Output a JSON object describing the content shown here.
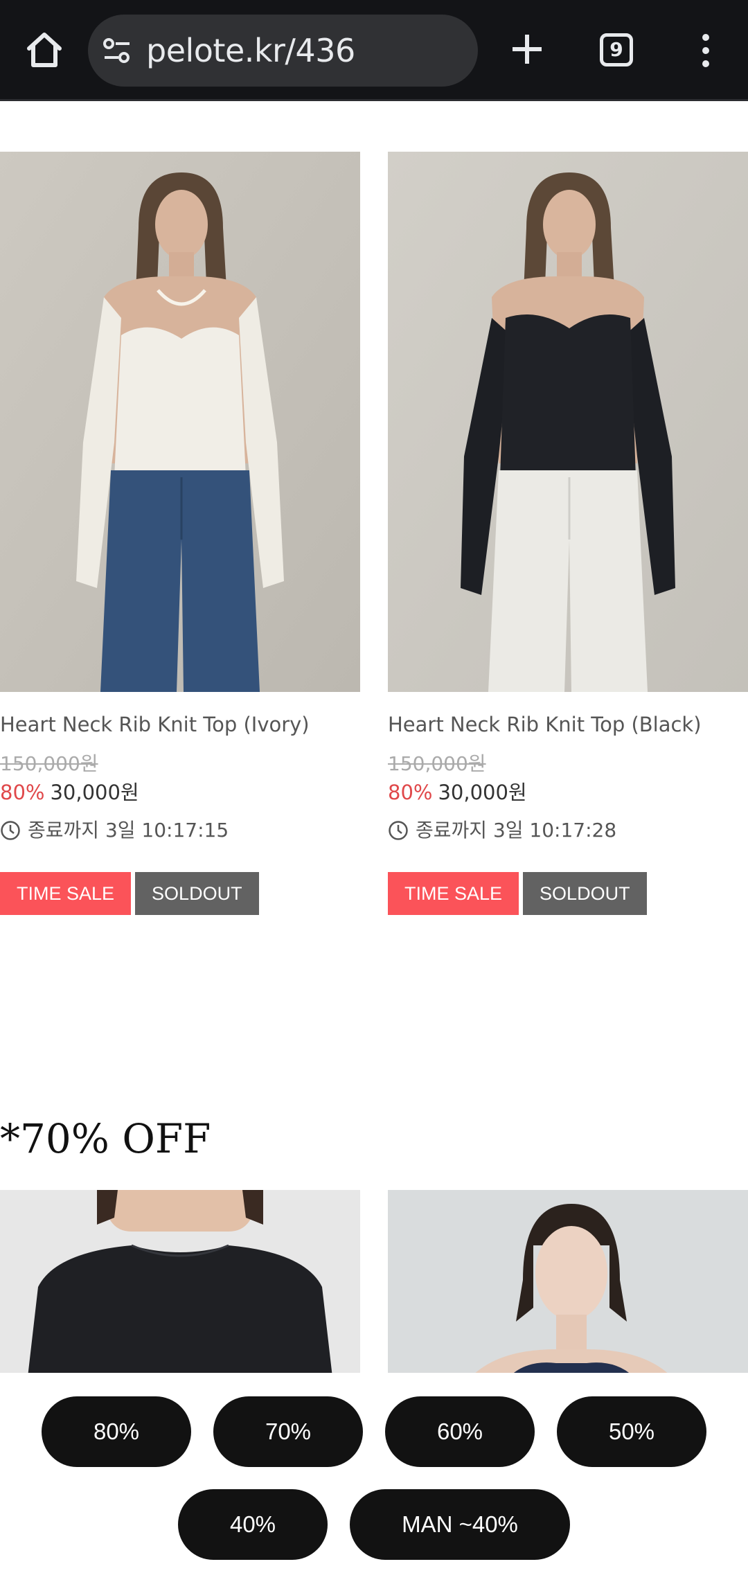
{
  "browser": {
    "url": "pelote.kr/436",
    "tab_count": "9"
  },
  "products": [
    {
      "name": "Heart Neck Rib Knit Top (Ivory)",
      "original_price": "150,000원",
      "discount": "80%",
      "price": "30,000원",
      "timer": "종료까지 3일 10:17:15",
      "tags": [
        "TIME SALE",
        "SOLDOUT"
      ]
    },
    {
      "name": "Heart Neck Rib Knit Top (Black)",
      "original_price": "150,000원",
      "discount": "80%",
      "price": "30,000원",
      "timer": "종료까지 3일 10:17:28",
      "tags": [
        "TIME SALE",
        "SOLDOUT"
      ]
    }
  ],
  "section": {
    "title": "*70% OFF"
  },
  "filters": [
    "80%",
    "70%",
    "60%",
    "50%",
    "40%",
    "MAN ~40%"
  ],
  "colors": {
    "time_sale": "#fb5359",
    "soldout": "#626262",
    "discount": "#e0484a",
    "pill": "#121212"
  }
}
